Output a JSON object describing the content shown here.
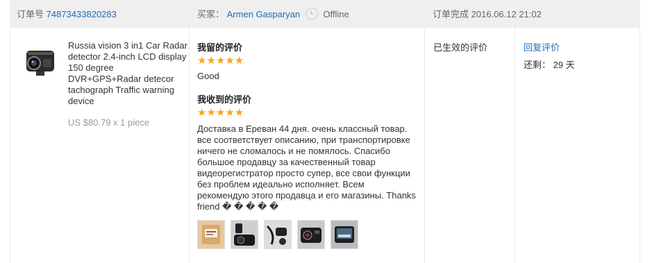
{
  "header": {
    "order_label": "订单号",
    "order_number": "74873433820283",
    "buyer_label": "买家：",
    "buyer_name": "Armen Gasparyan",
    "buyer_status": "Offline",
    "completed_label": "订单完成",
    "completed_time": "2016.06.12 21:02"
  },
  "product": {
    "image_icon": "dashcam-product-image",
    "title": "Russia vision 3 in1 Car Radar detector 2.4-inch LCD display 150 degree DVR+GPS+Radar detecor tachograph Traffic warning device",
    "price": "US $80.79 x 1 piece"
  },
  "my_feedback": {
    "heading": "我留的评价",
    "stars": 5,
    "stars_text": "★★★★★",
    "text": "Good"
  },
  "received_feedback": {
    "heading": "我收到的评价",
    "stars": 5,
    "stars_text": "★★★★★",
    "text": "Доставка в Ереван 44 дня. очень классный товар. все соответствует описанию, при транспортировке ничего не сломалось и не помялось. Спасибо большое продавцу за качественный товар видеорегистратор просто супер, все свои функции без проблем идеально исполняет. Всем рекомендую этого продавца и его магазины. Thanks friend � � � � �",
    "photo_icons": [
      "package-box-photo",
      "dashcam-mount-photo",
      "dashcam-cables-photo",
      "dashcam-screen-photo",
      "dashcam-installed-photo"
    ]
  },
  "status": {
    "text": "已生效的评价"
  },
  "actions": {
    "reply_label": "回复评价",
    "remaining_label": "还剩：",
    "remaining_value": "29 天"
  },
  "colors": {
    "link": "#1e6bb8",
    "star": "#f7a616",
    "header_bg": "#efefef"
  }
}
